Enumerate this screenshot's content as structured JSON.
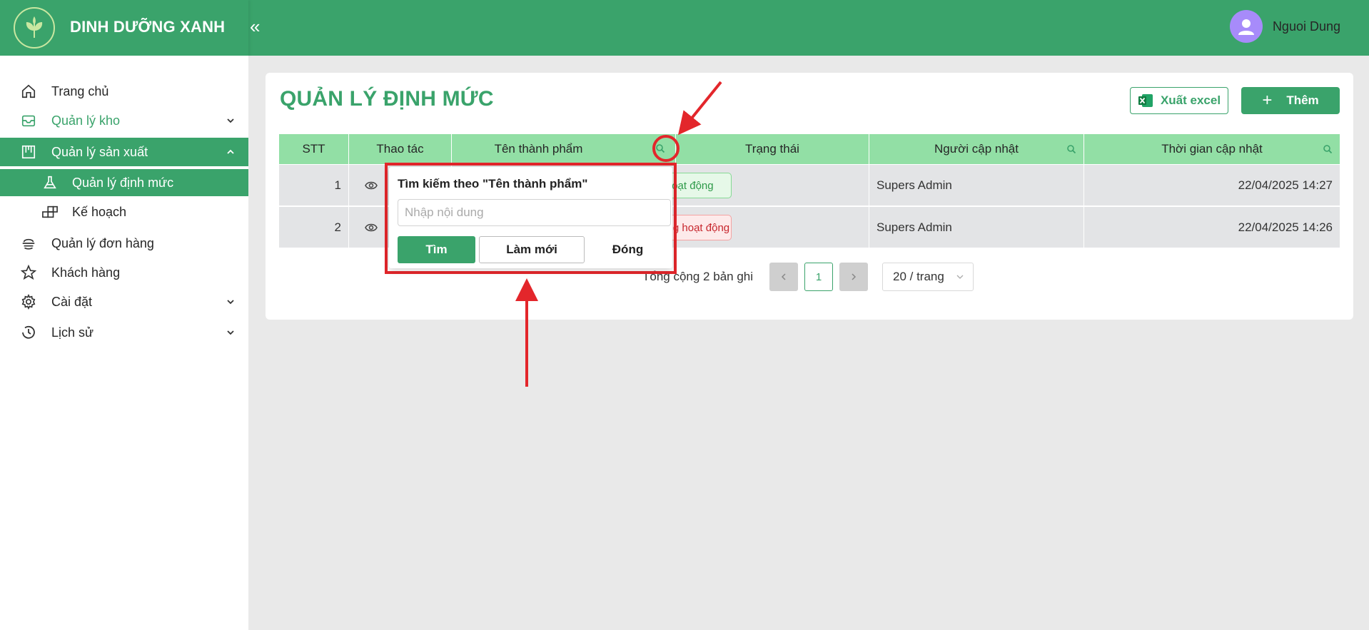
{
  "app": {
    "brand": "DINH DƯỠNG XANH",
    "collapse_glyph": "«"
  },
  "user": {
    "name": "Nguoi Dung"
  },
  "sidebar": {
    "items": [
      {
        "label": "Trang chủ",
        "icon": "home-icon"
      },
      {
        "label": "Quản lý kho",
        "icon": "inbox-icon"
      },
      {
        "label": "Quản lý sản xuất",
        "icon": "production-icon"
      },
      {
        "label": "Quản lý định mức",
        "icon": "flask-icon"
      },
      {
        "label": "Kế hoạch",
        "icon": "plan-icon"
      },
      {
        "label": "Quản lý đơn hàng",
        "icon": "order-icon"
      },
      {
        "label": "Khách hàng",
        "icon": "star-icon"
      },
      {
        "label": "Cài đặt",
        "icon": "gear-icon"
      },
      {
        "label": "Lịch sử",
        "icon": "history-icon"
      }
    ]
  },
  "main": {
    "title": "QUẢN LÝ ĐỊNH MỨC",
    "export_label": "Xuất excel",
    "add_label": "Thêm"
  },
  "table": {
    "headers": [
      "STT",
      "Thao tác",
      "Tên thành phẩm",
      "Trạng thái",
      "Người cập nhật",
      "Thời gian cập nhật"
    ],
    "rows": [
      {
        "stt": "1",
        "status": "Hoạt động",
        "updated_by": "Supers Admin",
        "updated_at": "22/04/2025 14:27"
      },
      {
        "stt": "2",
        "status": "Không hoạt động",
        "updated_by": "Supers Admin",
        "updated_at": "22/04/2025 14:26"
      }
    ]
  },
  "pagination": {
    "total_text": "Tổng cộng 2 bản ghi",
    "page": "1",
    "page_size": "20 / trang"
  },
  "search_popup": {
    "title": "Tìm kiếm theo \"Tên thành phẩm\"",
    "placeholder": "Nhập nội dung",
    "find_label": "Tìm",
    "reset_label": "Làm mới",
    "close_label": "Đóng"
  },
  "colors": {
    "primary": "#3aa36b",
    "header_row": "#92dfa5",
    "annotation": "#e3262b"
  }
}
